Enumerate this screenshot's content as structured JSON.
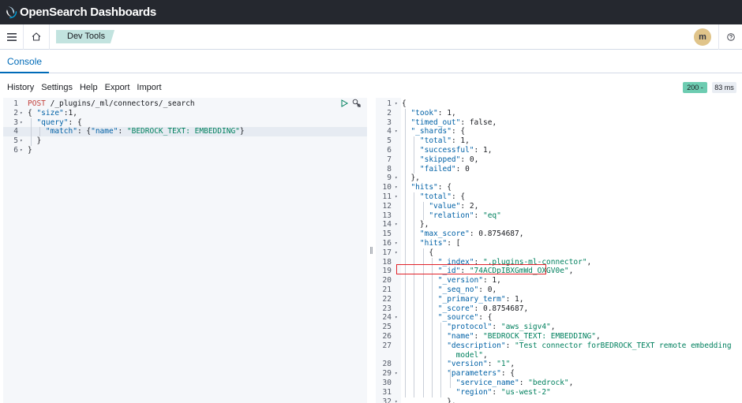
{
  "app": {
    "brand_open": "Open",
    "brand_search": "Search",
    "brand_dashboards": " Dashboards"
  },
  "header": {
    "breadcrumb": "Dev Tools",
    "avatar_initial": "m"
  },
  "tabs": {
    "console": "Console"
  },
  "toolbar": {
    "history": "History",
    "settings": "Settings",
    "help": "Help",
    "export": "Export",
    "import": "Import",
    "status": "200 -",
    "time": "83 ms"
  },
  "request": {
    "lines": [
      {
        "n": "1",
        "fold": false,
        "tokens": [
          [
            "method",
            "POST"
          ],
          [
            "url",
            " /_plugins/_ml/connectors/_search"
          ]
        ]
      },
      {
        "n": "2",
        "fold": true,
        "tokens": [
          [
            "punc",
            "{ "
          ],
          [
            "key",
            "\"size\""
          ],
          [
            "punc",
            ":"
          ],
          [
            "num",
            "1"
          ],
          [
            "punc",
            ","
          ]
        ]
      },
      {
        "n": "3",
        "fold": true,
        "tokens": [
          [
            "punc",
            "  "
          ],
          [
            "key",
            "\"query\""
          ],
          [
            "punc",
            ": {"
          ]
        ]
      },
      {
        "n": "4",
        "fold": false,
        "tokens": [
          [
            "punc",
            "    "
          ],
          [
            "key",
            "\"match\""
          ],
          [
            "punc",
            ": {"
          ],
          [
            "key",
            "\"name\""
          ],
          [
            "punc",
            ": "
          ],
          [
            "str",
            "\"BEDROCK_TEXT: EMBEDDING\""
          ],
          [
            "punc",
            "}"
          ]
        ]
      },
      {
        "n": "5",
        "fold": true,
        "tokens": [
          [
            "punc",
            "  }"
          ]
        ]
      },
      {
        "n": "6",
        "fold": true,
        "tokens": [
          [
            "punc",
            "}"
          ]
        ]
      }
    ]
  },
  "response": {
    "lines": [
      {
        "n": "1",
        "fold": true,
        "tokens": [
          [
            "punc",
            "{"
          ]
        ]
      },
      {
        "n": "2",
        "fold": false,
        "tokens": [
          [
            "punc",
            "  "
          ],
          [
            "key",
            "\"took\""
          ],
          [
            "punc",
            ": "
          ],
          [
            "num",
            "1"
          ],
          [
            "punc",
            ","
          ]
        ]
      },
      {
        "n": "3",
        "fold": false,
        "tokens": [
          [
            "punc",
            "  "
          ],
          [
            "key",
            "\"timed_out\""
          ],
          [
            "punc",
            ": "
          ],
          [
            "bool",
            "false"
          ],
          [
            "punc",
            ","
          ]
        ]
      },
      {
        "n": "4",
        "fold": true,
        "tokens": [
          [
            "punc",
            "  "
          ],
          [
            "key",
            "\"_shards\""
          ],
          [
            "punc",
            ": {"
          ]
        ]
      },
      {
        "n": "5",
        "fold": false,
        "tokens": [
          [
            "punc",
            "    "
          ],
          [
            "key",
            "\"total\""
          ],
          [
            "punc",
            ": "
          ],
          [
            "num",
            "1"
          ],
          [
            "punc",
            ","
          ]
        ]
      },
      {
        "n": "6",
        "fold": false,
        "tokens": [
          [
            "punc",
            "    "
          ],
          [
            "key",
            "\"successful\""
          ],
          [
            "punc",
            ": "
          ],
          [
            "num",
            "1"
          ],
          [
            "punc",
            ","
          ]
        ]
      },
      {
        "n": "7",
        "fold": false,
        "tokens": [
          [
            "punc",
            "    "
          ],
          [
            "key",
            "\"skipped\""
          ],
          [
            "punc",
            ": "
          ],
          [
            "num",
            "0"
          ],
          [
            "punc",
            ","
          ]
        ]
      },
      {
        "n": "8",
        "fold": false,
        "tokens": [
          [
            "punc",
            "    "
          ],
          [
            "key",
            "\"failed\""
          ],
          [
            "punc",
            ": "
          ],
          [
            "num",
            "0"
          ]
        ]
      },
      {
        "n": "9",
        "fold": true,
        "tokens": [
          [
            "punc",
            "  },"
          ]
        ]
      },
      {
        "n": "10",
        "fold": true,
        "tokens": [
          [
            "punc",
            "  "
          ],
          [
            "key",
            "\"hits\""
          ],
          [
            "punc",
            ": {"
          ]
        ]
      },
      {
        "n": "11",
        "fold": true,
        "tokens": [
          [
            "punc",
            "    "
          ],
          [
            "key",
            "\"total\""
          ],
          [
            "punc",
            ": {"
          ]
        ]
      },
      {
        "n": "12",
        "fold": false,
        "tokens": [
          [
            "punc",
            "      "
          ],
          [
            "key",
            "\"value\""
          ],
          [
            "punc",
            ": "
          ],
          [
            "num",
            "2"
          ],
          [
            "punc",
            ","
          ]
        ]
      },
      {
        "n": "13",
        "fold": false,
        "tokens": [
          [
            "punc",
            "      "
          ],
          [
            "key",
            "\"relation\""
          ],
          [
            "punc",
            ": "
          ],
          [
            "str",
            "\"eq\""
          ]
        ]
      },
      {
        "n": "14",
        "fold": true,
        "tokens": [
          [
            "punc",
            "    },"
          ]
        ]
      },
      {
        "n": "15",
        "fold": false,
        "tokens": [
          [
            "punc",
            "    "
          ],
          [
            "key",
            "\"max_score\""
          ],
          [
            "punc",
            ": "
          ],
          [
            "num",
            "0.8754687"
          ],
          [
            "punc",
            ","
          ]
        ]
      },
      {
        "n": "16",
        "fold": true,
        "tokens": [
          [
            "punc",
            "    "
          ],
          [
            "key",
            "\"hits\""
          ],
          [
            "punc",
            ": ["
          ]
        ]
      },
      {
        "n": "17",
        "fold": true,
        "tokens": [
          [
            "punc",
            "      {"
          ]
        ]
      },
      {
        "n": "18",
        "fold": false,
        "tokens": [
          [
            "punc",
            "        "
          ],
          [
            "key",
            "\"_index\""
          ],
          [
            "punc",
            ": "
          ],
          [
            "str",
            "\".plugins-ml-connector\""
          ],
          [
            "punc",
            ","
          ]
        ]
      },
      {
        "n": "19",
        "fold": false,
        "tokens": [
          [
            "punc",
            "        "
          ],
          [
            "key",
            "\"_id\""
          ],
          [
            "punc",
            ": "
          ],
          [
            "str",
            "\"74ACDpIBXGmWd_OXGV0e\""
          ],
          [
            "punc",
            ","
          ]
        ]
      },
      {
        "n": "20",
        "fold": false,
        "tokens": [
          [
            "punc",
            "        "
          ],
          [
            "key",
            "\"_version\""
          ],
          [
            "punc",
            ": "
          ],
          [
            "num",
            "1"
          ],
          [
            "punc",
            ","
          ]
        ]
      },
      {
        "n": "21",
        "fold": false,
        "tokens": [
          [
            "punc",
            "        "
          ],
          [
            "key",
            "\"_seq_no\""
          ],
          [
            "punc",
            ": "
          ],
          [
            "num",
            "0"
          ],
          [
            "punc",
            ","
          ]
        ]
      },
      {
        "n": "22",
        "fold": false,
        "tokens": [
          [
            "punc",
            "        "
          ],
          [
            "key",
            "\"_primary_term\""
          ],
          [
            "punc",
            ": "
          ],
          [
            "num",
            "1"
          ],
          [
            "punc",
            ","
          ]
        ]
      },
      {
        "n": "23",
        "fold": false,
        "tokens": [
          [
            "punc",
            "        "
          ],
          [
            "key",
            "\"_score\""
          ],
          [
            "punc",
            ": "
          ],
          [
            "num",
            "0.8754687"
          ],
          [
            "punc",
            ","
          ]
        ]
      },
      {
        "n": "24",
        "fold": true,
        "tokens": [
          [
            "punc",
            "        "
          ],
          [
            "key",
            "\"_source\""
          ],
          [
            "punc",
            ": {"
          ]
        ]
      },
      {
        "n": "25",
        "fold": false,
        "tokens": [
          [
            "punc",
            "          "
          ],
          [
            "key",
            "\"protocol\""
          ],
          [
            "punc",
            ": "
          ],
          [
            "str",
            "\"aws_sigv4\""
          ],
          [
            "punc",
            ","
          ]
        ]
      },
      {
        "n": "26",
        "fold": false,
        "tokens": [
          [
            "punc",
            "          "
          ],
          [
            "key",
            "\"name\""
          ],
          [
            "punc",
            ": "
          ],
          [
            "str",
            "\"BEDROCK_TEXT: EMBEDDING\""
          ],
          [
            "punc",
            ","
          ]
        ]
      },
      {
        "n": "27",
        "fold": false,
        "tokens": [
          [
            "punc",
            "          "
          ],
          [
            "key",
            "\"description\""
          ],
          [
            "punc",
            ": "
          ],
          [
            "str",
            "\"Test connector forBEDROCK_TEXT remote embedding"
          ]
        ]
      },
      {
        "n": "",
        "fold": false,
        "tokens": [
          [
            "str",
            "            model\""
          ],
          [
            "punc",
            ","
          ]
        ]
      },
      {
        "n": "28",
        "fold": false,
        "tokens": [
          [
            "punc",
            "          "
          ],
          [
            "key",
            "\"version\""
          ],
          [
            "punc",
            ": "
          ],
          [
            "str",
            "\"1\""
          ],
          [
            "punc",
            ","
          ]
        ]
      },
      {
        "n": "29",
        "fold": true,
        "tokens": [
          [
            "punc",
            "          "
          ],
          [
            "key",
            "\"parameters\""
          ],
          [
            "punc",
            ": {"
          ]
        ]
      },
      {
        "n": "30",
        "fold": false,
        "tokens": [
          [
            "punc",
            "            "
          ],
          [
            "key",
            "\"service_name\""
          ],
          [
            "punc",
            ": "
          ],
          [
            "str",
            "\"bedrock\""
          ],
          [
            "punc",
            ","
          ]
        ]
      },
      {
        "n": "31",
        "fold": false,
        "tokens": [
          [
            "punc",
            "            "
          ],
          [
            "key",
            "\"region\""
          ],
          [
            "punc",
            ": "
          ],
          [
            "str",
            "\"us-west-2\""
          ]
        ]
      },
      {
        "n": "32",
        "fold": true,
        "tokens": [
          [
            "punc",
            "          },"
          ]
        ]
      }
    ]
  },
  "colors": {
    "brand_bar": "#25282f",
    "accent": "#006bb8",
    "status_ok": "#6dccb1",
    "highlight_box": "#e2232a"
  }
}
